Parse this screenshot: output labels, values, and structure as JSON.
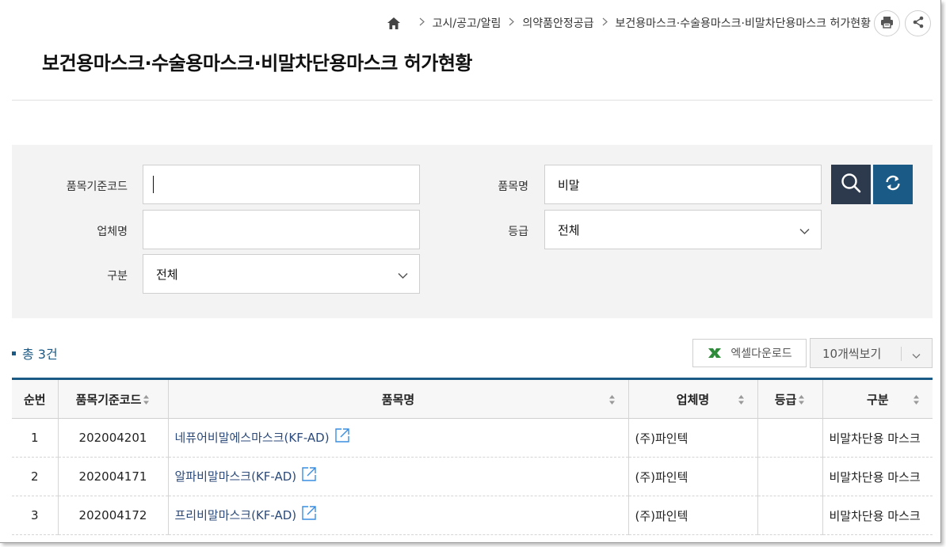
{
  "breadcrumb": {
    "items": [
      "고시/공고/알림",
      "의약품안정공급",
      "보건용마스크·수술용마스크·비말차단용마스크 허가현황"
    ]
  },
  "header": {
    "title": "보건용마스크·수술용마스크·비말차단용마스크 허가현황"
  },
  "search": {
    "item_code_label": "품목기준코드",
    "item_code_value": "",
    "item_name_label": "품목명",
    "item_name_value": "비말",
    "company_label": "업체명",
    "company_value": "",
    "grade_label": "등급",
    "grade_value": "전체",
    "category_label": "구분",
    "category_value": "전체"
  },
  "results": {
    "total_text": "총 3건",
    "excel_label": "엑셀다운로드",
    "per_page": "10개씩보기"
  },
  "table": {
    "headers": [
      "순번",
      "품목기준코드",
      "품목명",
      "업체명",
      "등급",
      "구분"
    ],
    "rows": [
      {
        "no": "1",
        "code": "202004201",
        "name": "네퓨어비말에스마스크(KF-AD)",
        "company": "(주)파인텍",
        "grade": "",
        "category": "비말차단용 마스크"
      },
      {
        "no": "2",
        "code": "202004171",
        "name": "알파비말마스크(KF-AD)",
        "company": "(주)파인텍",
        "grade": "",
        "category": "비말차단용 마스크"
      },
      {
        "no": "3",
        "code": "202004172",
        "name": "프리비말마스크(KF-AD)",
        "company": "(주)파인텍",
        "grade": "",
        "category": "비말차단용 마스크"
      }
    ]
  },
  "colors": {
    "accent": "#1a5a86",
    "search_button": "#2d3a4d",
    "panel_bg": "#f3f3f3",
    "link": "#2b4a7a",
    "excel_green": "#2e8b3a"
  },
  "icons": [
    "home-icon",
    "chevron-right-icon",
    "print-icon",
    "share-icon",
    "search-icon",
    "refresh-icon",
    "chevron-down-icon",
    "excel-icon",
    "sort-icon",
    "external-link-icon"
  ]
}
